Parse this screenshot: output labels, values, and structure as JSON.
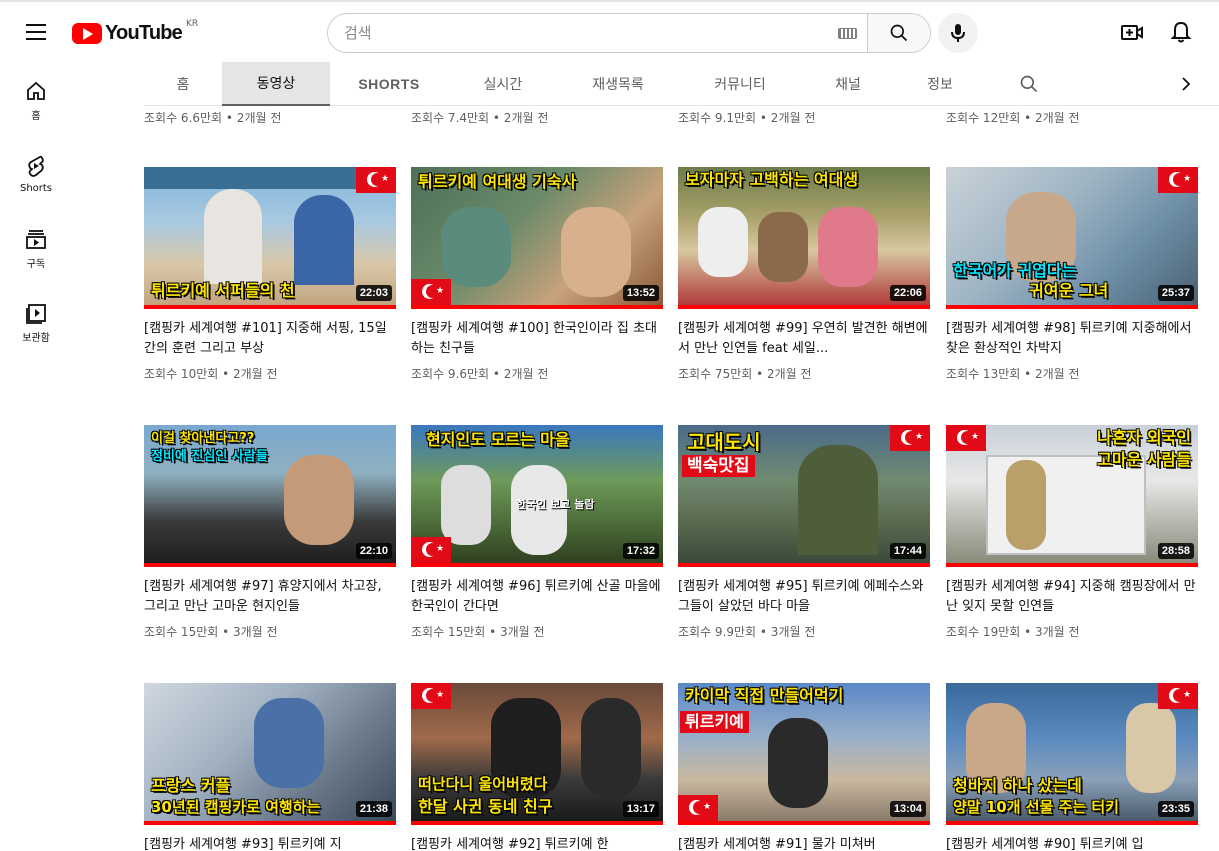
{
  "header": {
    "logo_text": "YouTube",
    "logo_region": "KR",
    "search_placeholder": "검색"
  },
  "sidebar": [
    {
      "label": "홈",
      "icon": "home-icon"
    },
    {
      "label": "Shorts",
      "icon": "shorts-icon"
    },
    {
      "label": "구독",
      "icon": "subscriptions-icon"
    },
    {
      "label": "보관함",
      "icon": "library-icon"
    }
  ],
  "tabs": [
    "홈",
    "동영상",
    "SHORTS",
    "실시간",
    "재생목록",
    "커뮤니티",
    "채널",
    "정보"
  ],
  "active_tab": "동영상",
  "top_row_meta": [
    "조회수 6.6만회 • 2개월 전",
    "조회수 7.4만회 • 2개월 전",
    "조회수 9.1만회 • 2개월 전",
    "조회수 12만회 • 2개월 전"
  ],
  "videos": [
    {
      "title": "[캠핑카 세계여행 #101] 지중해 서핑, 15일간의 훈련 그리고 부상",
      "meta": "조회수 10만회 • 2개월 전",
      "duration": "22:03",
      "caption": "튀르키예 서퍼들의 천"
    },
    {
      "title": "[캠핑카 세계여행 #100] 한국인이라 집 초대하는 친구들",
      "meta": "조회수 9.6만회 • 2개월 전",
      "duration": "13:52",
      "caption": "튀르키예 여대생 기숙사"
    },
    {
      "title": "[캠핑카 세계여행 #99] 우연히 발견한 해변에서 만난 인연들 feat 세일...",
      "meta": "조회수 75만회 • 2개월 전",
      "duration": "22:06",
      "caption": "보자마자 고백하는 여대생"
    },
    {
      "title": "[캠핑카 세계여행 #98] 튀르키예 지중해에서 찾은 환상적인 차박지",
      "meta": "조회수 13만회 • 2개월 전",
      "duration": "25:37",
      "caption": "한국어가 귀엽다는",
      "caption2": "귀여운 그녀"
    },
    {
      "title": "[캠핑카 세계여행 #97] 휴양지에서 차고장, 그리고 만난 고마운 현지인들",
      "meta": "조회수 15만회 • 3개월 전",
      "duration": "22:10",
      "caption": "이걸 찾아낸다고??",
      "caption2": "정비에 진심인 사람들"
    },
    {
      "title": "[캠핑카 세계여행 #96] 튀르키예 산골 마을에 한국인이 간다면",
      "meta": "조회수 15만회 • 3개월 전",
      "duration": "17:32",
      "caption": "현지인도 모르는 마을",
      "caption2": "한국인 보고 놀람"
    },
    {
      "title": "[캠핑카 세계여행 #95] 튀르키예 에페수스와 그들이 살았던 바다 마을",
      "meta": "조회수 9.9만회 • 3개월 전",
      "duration": "17:44",
      "caption": "고대도시",
      "caption2": "백숙맛집"
    },
    {
      "title": "[캠핑카 세계여행 #94] 지중해 캠핑장에서 만난 잊지 못할 인연들",
      "meta": "조회수 19만회 • 3개월 전",
      "duration": "28:58",
      "caption": "나혼자 외국인",
      "caption2": "고마운 사람들"
    },
    {
      "title": "[캠핑카 세계여행 #93] 튀르키예 지",
      "meta": "",
      "duration": "21:38",
      "caption": "프랑스 커플",
      "caption2": "30년된 캠핑카로 여행하는"
    },
    {
      "title": "[캠핑카 세계여행 #92] 튀르키예 한",
      "meta": "",
      "duration": "13:17",
      "caption": "떠난다니 울어버렸다",
      "caption2": "한달 사귄 동네 친구"
    },
    {
      "title": "[캠핑카 세계여행 #91] 물가 미쳐버",
      "meta": "",
      "duration": "13:04",
      "caption": "카이막 직접 만들어먹기",
      "caption2": "튀르키예"
    },
    {
      "title": "[캠핑카 세계여행 #90] 튀르키예 입",
      "meta": "",
      "duration": "23:35",
      "caption": "청바지 하나 샀는데",
      "caption2": "양말 10개 선물 주는 터키"
    }
  ],
  "colors": {
    "accent": "#ff0000",
    "meta_text": "#606060",
    "caption_yellow": "#ffe600",
    "flag_red": "#e30a17"
  }
}
